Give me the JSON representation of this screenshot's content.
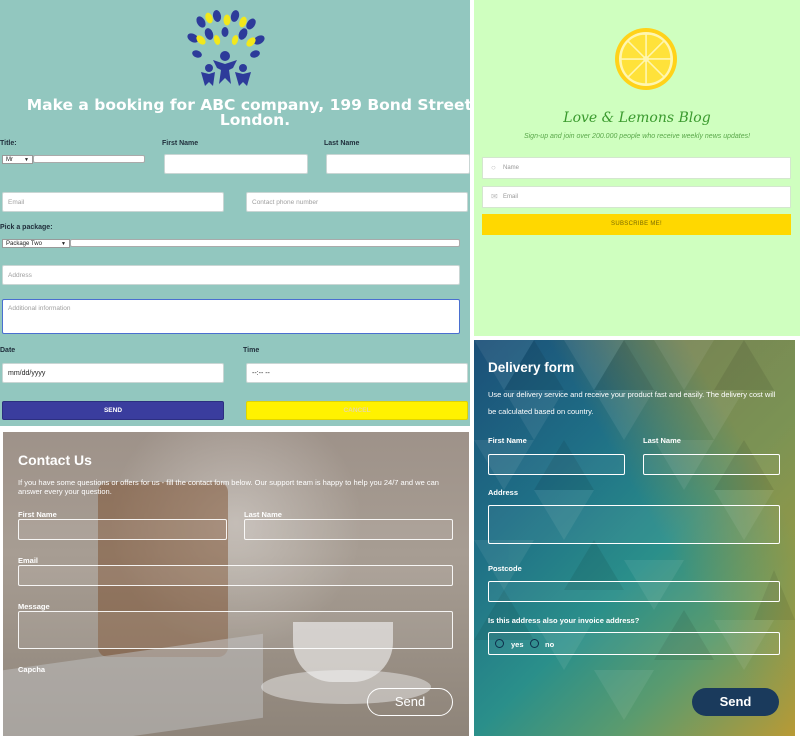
{
  "booking": {
    "title": "Make a booking for ABC company, 199 Bond Street , London.",
    "title_label": "Title:",
    "title_value": "Mr",
    "first_name_label": "First Name",
    "last_name_label": "Last Name",
    "email_placeholder": "Email",
    "phone_placeholder": "Contact phone number",
    "package_label": "Pick a package:",
    "package_value": "Package Two",
    "address_placeholder": "Address",
    "info_placeholder": "Additional information",
    "date_label": "Date",
    "date_value": "mm/dd/yyyy",
    "time_label": "Time",
    "time_value": "--:-- --",
    "send_label": "SEND",
    "cancel_label": "CANCEL",
    "colors": {
      "background": "#92c7bf",
      "send": "#3a3d9e",
      "cancel": "#fff200"
    }
  },
  "lemons": {
    "title": "Love & Lemons Blog",
    "subtitle": "Sign-up and join over 200.000 people who receive weekly news updates!",
    "name_placeholder": "Name",
    "email_placeholder": "Email",
    "subscribe_label": "SUBSCRIBE ME!",
    "icons": {
      "name": "user-icon",
      "email": "mail-icon"
    },
    "colors": {
      "background": "#cfffbf",
      "button": "#ffd800"
    }
  },
  "contact": {
    "title": "Contact Us",
    "description": "If you have some questions or offers for us - fill the contact form below. Our support team is happy to help you 24/7 and we can answer every your question.",
    "first_name_label": "First Name",
    "last_name_label": "Last Name",
    "email_label": "Email",
    "message_label": "Message",
    "captcha_label": "Capcha",
    "send_label": "Send"
  },
  "delivery": {
    "title": "Delivery form",
    "description": "Use our delivery service and receive your product fast and easily. The delivery cost will be calculated based on country.",
    "first_name_label": "First Name",
    "last_name_label": "Last Name",
    "address_label": "Address",
    "postcode_label": "Postcode",
    "invoice_question": "Is this address also your invoice address?",
    "option_yes": "yes",
    "option_no": "no",
    "send_label": "Send",
    "colors": {
      "button": "#1a3a5c"
    }
  }
}
